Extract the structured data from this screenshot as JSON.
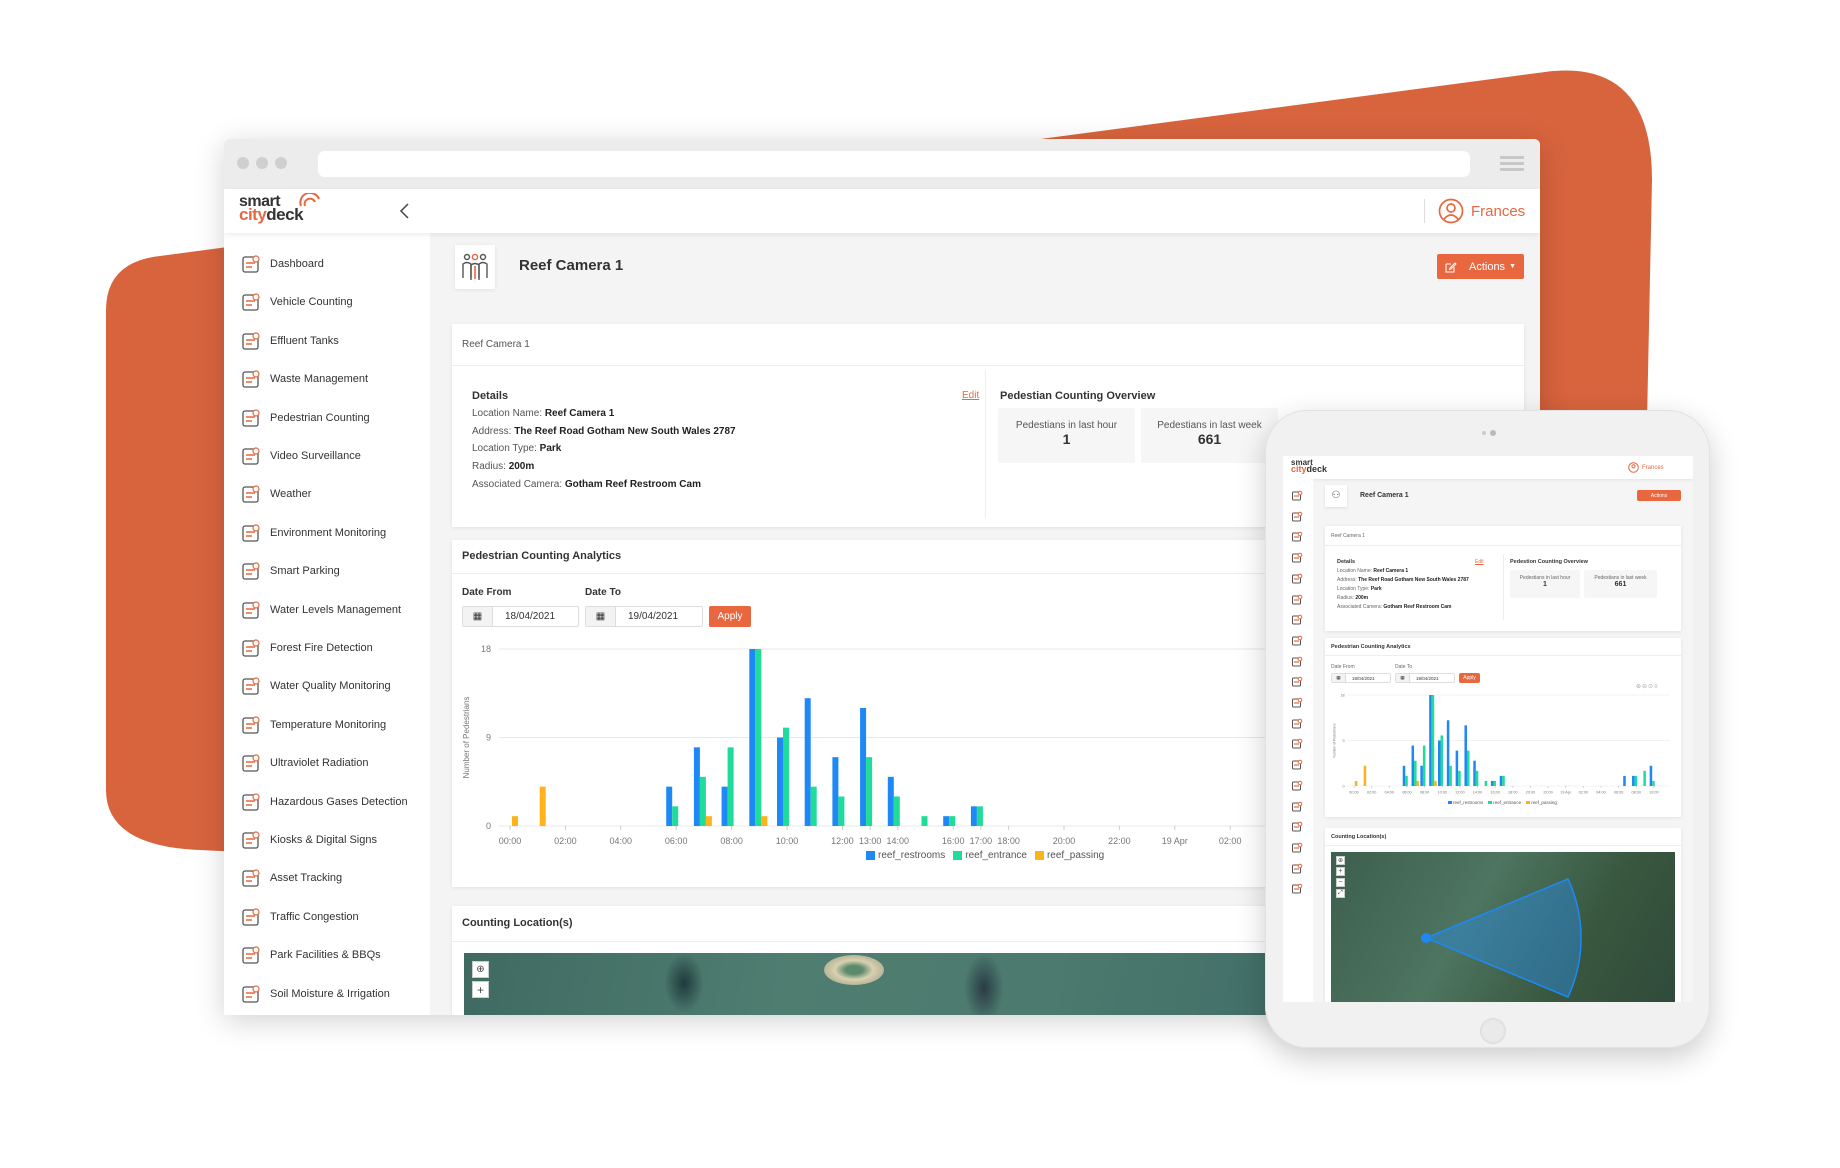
{
  "colors": {
    "brand": "#e8673f",
    "background_shape": "#d8643d",
    "reef_restrooms": "#1e88f5",
    "reef_entrance": "#1fdc98",
    "reef_passing": "#ffb21a"
  },
  "app": {
    "logo_top": "smart",
    "logo_bottom_a": "city",
    "logo_bottom_b": "deck",
    "user": "Frances",
    "collapse_icon": "chevron-left-icon",
    "user_icon": "user-circle-icon"
  },
  "sidebar": {
    "items": [
      {
        "label": "Dashboard",
        "icon": "dashboard-icon"
      },
      {
        "label": "Vehicle Counting",
        "icon": "car-icon"
      },
      {
        "label": "Effluent Tanks",
        "icon": "tank-icon"
      },
      {
        "label": "Waste Management",
        "icon": "bin-icon"
      },
      {
        "label": "Pedestrian Counting",
        "icon": "people-icon"
      },
      {
        "label": "Video Surveillance",
        "icon": "camera-icon"
      },
      {
        "label": "Weather",
        "icon": "weather-icon"
      },
      {
        "label": "Environment Monitoring",
        "icon": "leaf-icon"
      },
      {
        "label": "Smart Parking",
        "icon": "parking-icon"
      },
      {
        "label": "Water Levels Management",
        "icon": "water-drops-icon"
      },
      {
        "label": "Forest Fire Detection",
        "icon": "fire-icon"
      },
      {
        "label": "Water Quality Monitoring",
        "icon": "water-quality-icon"
      },
      {
        "label": "Temperature Monitoring",
        "icon": "thermometer-icon"
      },
      {
        "label": "Ultraviolet Radiation",
        "icon": "sun-icon"
      },
      {
        "label": "Hazardous Gases Detection",
        "icon": "gas-icon"
      },
      {
        "label": "Kiosks & Digital Signs",
        "icon": "kiosk-icon"
      },
      {
        "label": "Asset Tracking",
        "icon": "tracking-icon"
      },
      {
        "label": "Traffic Congestion",
        "icon": "traffic-icon"
      },
      {
        "label": "Park Facilities & BBQs",
        "icon": "bbq-icon"
      },
      {
        "label": "Soil Moisture & Irrigation",
        "icon": "plant-icon"
      }
    ]
  },
  "page": {
    "title": "Reef Camera 1",
    "title_icon": "pedestrian-group-icon",
    "actions_label": "Actions",
    "actions_icon": "edit-icon"
  },
  "details_card": {
    "header": "Reef Camera 1",
    "heading": "Details",
    "edit": "Edit",
    "rows": [
      {
        "label": "Location Name:",
        "value": "Reef Camera 1"
      },
      {
        "label": "Address:",
        "value": "The Reef Road Gotham New South Wales 2787"
      },
      {
        "label": "Location Type:",
        "value": "Park"
      },
      {
        "label": "Radius:",
        "value": "200m"
      },
      {
        "label": "Associated Camera:",
        "value": "Gotham Reef Restroom Cam"
      }
    ],
    "overview_heading": "Pedestian Counting Overview",
    "overview_heading_tablet": "Pedestion Counting Overview",
    "stats": [
      {
        "label": "Pedestians in last hour",
        "value": "1"
      },
      {
        "label": "Pedestians in last week",
        "value": "661"
      }
    ]
  },
  "analytics": {
    "title": "Pedestrian Counting Analytics",
    "date_from_label": "Date From",
    "date_to_label": "Date To",
    "date_from": "18/04/2021",
    "date_to": "19/04/2021",
    "apply": "Apply"
  },
  "locations": {
    "title": "Counting Location(s)"
  },
  "chart_data": [
    {
      "type": "bar",
      "ylabel": "Number of Pedestrians",
      "ylim": [
        0,
        18
      ],
      "yticks": [
        "0",
        "9",
        "18"
      ],
      "grid": true,
      "legend": "bottom",
      "x": [
        "18 Apr 00:00",
        "01:00",
        "02:00",
        "03:00",
        "04:00",
        "05:00",
        "06:00",
        "07:00",
        "08:00",
        "09:00",
        "10:00",
        "11:00",
        "12:00",
        "13:00",
        "14:00",
        "15:00",
        "16:00",
        "17:00"
      ],
      "xtick_labels": [
        "00:00",
        "02:00",
        "04:00",
        "06:00",
        "08:00",
        "10:00",
        "12:00",
        "13:00",
        "14:00",
        "16:00",
        "17:00",
        "18:00",
        "20:00",
        "22:00",
        "19 Apr",
        "02:00"
      ],
      "series": [
        {
          "name": "reef_restrooms",
          "values": [
            0,
            0,
            0,
            0,
            0,
            0,
            4,
            8,
            4,
            18,
            9,
            13,
            7,
            12,
            5,
            0,
            1,
            2
          ]
        },
        {
          "name": "reef_entrance",
          "values": [
            0,
            0,
            0,
            0,
            0,
            0,
            2,
            5,
            8,
            18,
            10,
            4,
            3,
            7,
            3,
            1,
            1,
            2
          ]
        },
        {
          "name": "reef_passing",
          "values": [
            1,
            4,
            0,
            0,
            0,
            0,
            0,
            1,
            0,
            1,
            0,
            0,
            0,
            0,
            0,
            0,
            0,
            0
          ]
        }
      ]
    },
    {
      "type": "bar",
      "ylabel": "Number of Pedestrians",
      "ylim": [
        0,
        18
      ],
      "yticks": [
        "0",
        "9",
        "18"
      ],
      "grid": true,
      "legend": "bottom",
      "x": [
        "18 Apr 00:00",
        "01:00",
        "02:00",
        "03:00",
        "04:00",
        "05:00",
        "06:00",
        "07:00",
        "08:00",
        "09:00",
        "10:00",
        "11:00",
        "12:00",
        "13:00",
        "14:00",
        "15:00",
        "16:00",
        "17:00",
        "18:00",
        "19:00",
        "20:00",
        "21:00",
        "22:00",
        "23:00",
        "19 Apr 00:00",
        "01:00",
        "02:00",
        "03:00",
        "04:00",
        "05:00",
        "06:00",
        "07:00",
        "08:00",
        "09:00",
        "10:00"
      ],
      "xtick_labels": [
        "00:00",
        "02:00",
        "04:00",
        "06:00",
        "08:00",
        "10:00",
        "12:00",
        "14:00",
        "16:00",
        "18:00",
        "20:00",
        "22:00",
        "19 Apr",
        "02:00",
        "04:00",
        "06:00",
        "08:00",
        "10:00"
      ],
      "series": [
        {
          "name": "reef_restrooms",
          "values": [
            0,
            0,
            0,
            0,
            0,
            0,
            4,
            8,
            4,
            18,
            9,
            13,
            7,
            12,
            5,
            0,
            1,
            2,
            0,
            0,
            0,
            0,
            0,
            0,
            0,
            0,
            0,
            0,
            0,
            0,
            0,
            2,
            2,
            0,
            4
          ]
        },
        {
          "name": "reef_entrance",
          "values": [
            0,
            0,
            0,
            0,
            0,
            0,
            2,
            5,
            8,
            18,
            10,
            4,
            3,
            7,
            3,
            1,
            1,
            2,
            0,
            0,
            0,
            0,
            0,
            0,
            0,
            0,
            0,
            0,
            0,
            0,
            0,
            0,
            2,
            3,
            1
          ]
        },
        {
          "name": "reef_passing",
          "values": [
            1,
            4,
            0,
            0,
            0,
            0,
            0,
            1,
            0,
            1,
            0,
            0,
            0,
            0,
            0,
            0,
            0,
            0,
            0,
            0,
            0,
            0,
            0,
            0,
            0,
            0,
            0,
            0,
            0,
            0,
            0,
            0,
            0,
            0,
            0
          ]
        }
      ]
    }
  ]
}
